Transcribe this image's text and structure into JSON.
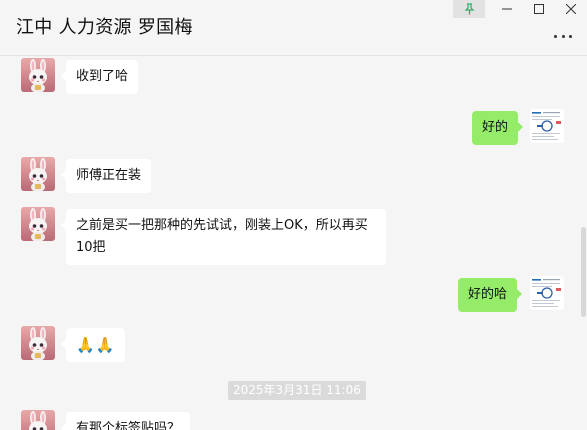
{
  "window": {
    "title": "江中 人力资源 罗国梅"
  },
  "controls": {
    "pin_icon": "pin-icon",
    "minimize_icon": "minimize-icon",
    "maximize_icon": "maximize-icon",
    "close_icon": "close-icon",
    "more_icon": "more-icon"
  },
  "messages": [
    {
      "side": "in",
      "text": "收到了哈"
    },
    {
      "side": "out",
      "text": "好的"
    },
    {
      "side": "in",
      "text": "师傅正在装"
    },
    {
      "side": "in",
      "text": "之前是买一把那种的先试试，刚装上OK，所以再买10把"
    },
    {
      "side": "out",
      "text": "好的哈"
    },
    {
      "side": "in",
      "text": "🙏🙏"
    },
    {
      "side": "in",
      "text": "有那个标签贴吗？"
    }
  ],
  "timestamp": "2025年3月31日 11:06",
  "colors": {
    "background": "#f5f5f5",
    "incoming_bubble": "#ffffff",
    "outgoing_bubble": "#95ec69",
    "timestamp_bg": "#dadada"
  }
}
